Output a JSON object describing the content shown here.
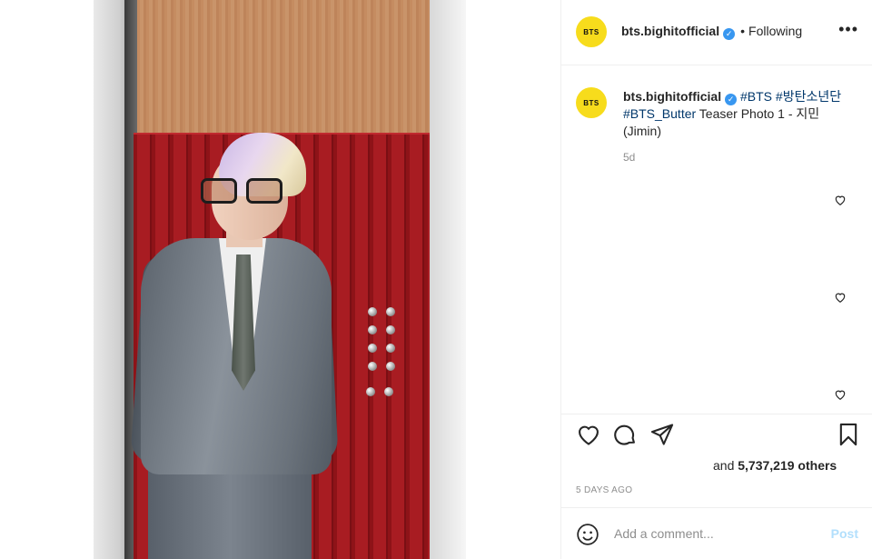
{
  "header": {
    "avatar_text": "BTS",
    "username": "bts.bighitofficial",
    "separator": "•",
    "follow_status": "Following",
    "more_icon": "more-options-icon"
  },
  "caption": {
    "avatar_text": "BTS",
    "username": "bts.bighitofficial",
    "tag1": "#BTS",
    "tag2": "#방탄소년단",
    "tag3": "#BTS_Butter",
    "text1": " Teaser Photo 1 - 지민",
    "text2": "(Jimin)",
    "age": "5d"
  },
  "likes": {
    "prefix": "and ",
    "count": "5,737,219 others"
  },
  "post_date": "5 DAYS AGO",
  "comment": {
    "placeholder": "Add a comment...",
    "post_label": "Post"
  },
  "icons": {
    "like": "heart-icon",
    "comment": "comment-icon",
    "share": "share-icon",
    "save": "bookmark-icon",
    "emoji": "emoji-icon"
  },
  "colors": {
    "avatar_bg": "#f7dc1c",
    "verified": "#3897f0",
    "hashtag": "#00376b",
    "post_disabled": "#b2dffc"
  }
}
